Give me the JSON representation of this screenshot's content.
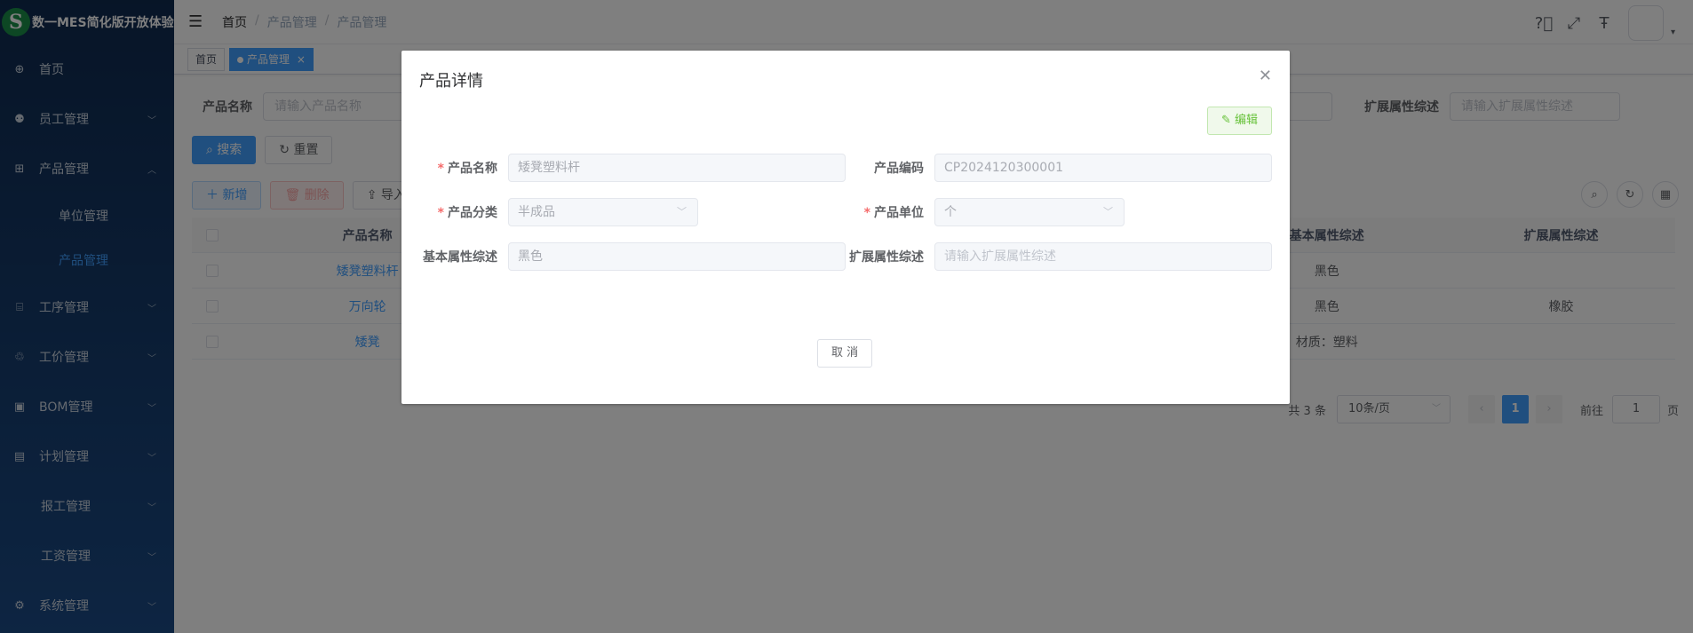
{
  "app": {
    "logo_glyph": "S",
    "title": "数一MES简化版开放体验"
  },
  "sidebar": {
    "items": [
      {
        "label": "首页",
        "icon": "dashboard-icon",
        "glyph": "⊕",
        "has_children": false
      },
      {
        "label": "员工管理",
        "icon": "peoples-icon",
        "glyph": "⚉",
        "has_children": true,
        "expanded": false
      },
      {
        "label": "产品管理",
        "icon": "grid-icon",
        "glyph": "⊞",
        "has_children": true,
        "expanded": true
      },
      {
        "label": "工序管理",
        "icon": "process-icon",
        "glyph": "⌸",
        "has_children": true,
        "expanded": false
      },
      {
        "label": "工价管理",
        "icon": "price-icon",
        "glyph": "♲",
        "has_children": true,
        "expanded": false
      },
      {
        "label": "BOM管理",
        "icon": "bom-icon",
        "glyph": "▣",
        "has_children": true,
        "expanded": false
      },
      {
        "label": "计划管理",
        "icon": "plan-icon",
        "glyph": "▤",
        "has_children": true,
        "expanded": false
      },
      {
        "label": "报工管理",
        "icon": "",
        "glyph": "",
        "has_children": true,
        "expanded": false
      },
      {
        "label": "工资管理",
        "icon": "",
        "glyph": "",
        "has_children": true,
        "expanded": false
      },
      {
        "label": "系统管理",
        "icon": "system-icon",
        "glyph": "⚙",
        "has_children": true,
        "expanded": false
      }
    ],
    "subitems": [
      {
        "label": "单位管理",
        "active": false
      },
      {
        "label": "产品管理",
        "active": true
      }
    ]
  },
  "navbar": {
    "breadcrumb": [
      "首页",
      "产品管理",
      "产品管理"
    ],
    "icons": [
      "question-icon",
      "fullscreen-icon",
      "font-size-icon"
    ]
  },
  "tags": [
    {
      "label": "首页",
      "active": false
    },
    {
      "label": "产品管理",
      "active": true,
      "close": "×"
    }
  ],
  "search": {
    "name_label": "产品名称",
    "name_placeholder": "请输入产品名称",
    "ext_label": "扩展属性综述",
    "ext_placeholder": "请输入扩展属性综述",
    "search_button": "搜索",
    "reset_button": "重置"
  },
  "toolbar": {
    "add_button": "新增",
    "delete_button": "删除",
    "import_button": "导入"
  },
  "table": {
    "headers": {
      "name": "产品名称",
      "basic": "基本属性综述",
      "ext": "扩展属性综述"
    },
    "rows": [
      {
        "name": "矮凳塑料杆",
        "basic": "黑色",
        "ext": ""
      },
      {
        "name": "万向轮",
        "basic": "黑色",
        "ext": "橡胶"
      },
      {
        "name": "矮凳",
        "basic": "材质：塑料",
        "ext": ""
      }
    ]
  },
  "pagination": {
    "total": "共 3 条",
    "page_size": "10条/页",
    "current": "1",
    "goto_label": "前往",
    "goto_value": "1",
    "page_suffix": "页"
  },
  "dialog": {
    "title": "产品详情",
    "edit_button": "编辑",
    "fields": {
      "name_label": "产品名称",
      "name_value": "矮凳塑料杆",
      "code_label": "产品编码",
      "code_value": "CP2024120300001",
      "category_label": "产品分类",
      "category_value": "半成品",
      "unit_label": "产品单位",
      "unit_value": "个",
      "basic_label": "基本属性综述",
      "basic_value": "黑色",
      "ext_label": "扩展属性综述",
      "ext_placeholder": "请输入扩展属性综述"
    },
    "cancel_button": "取 消"
  },
  "colors": {
    "primary": "#409eff",
    "success": "#67c23a",
    "danger": "#f56c6c",
    "sidebar_top": "#0f2a4f",
    "sidebar_bottom": "#1b4a85"
  }
}
